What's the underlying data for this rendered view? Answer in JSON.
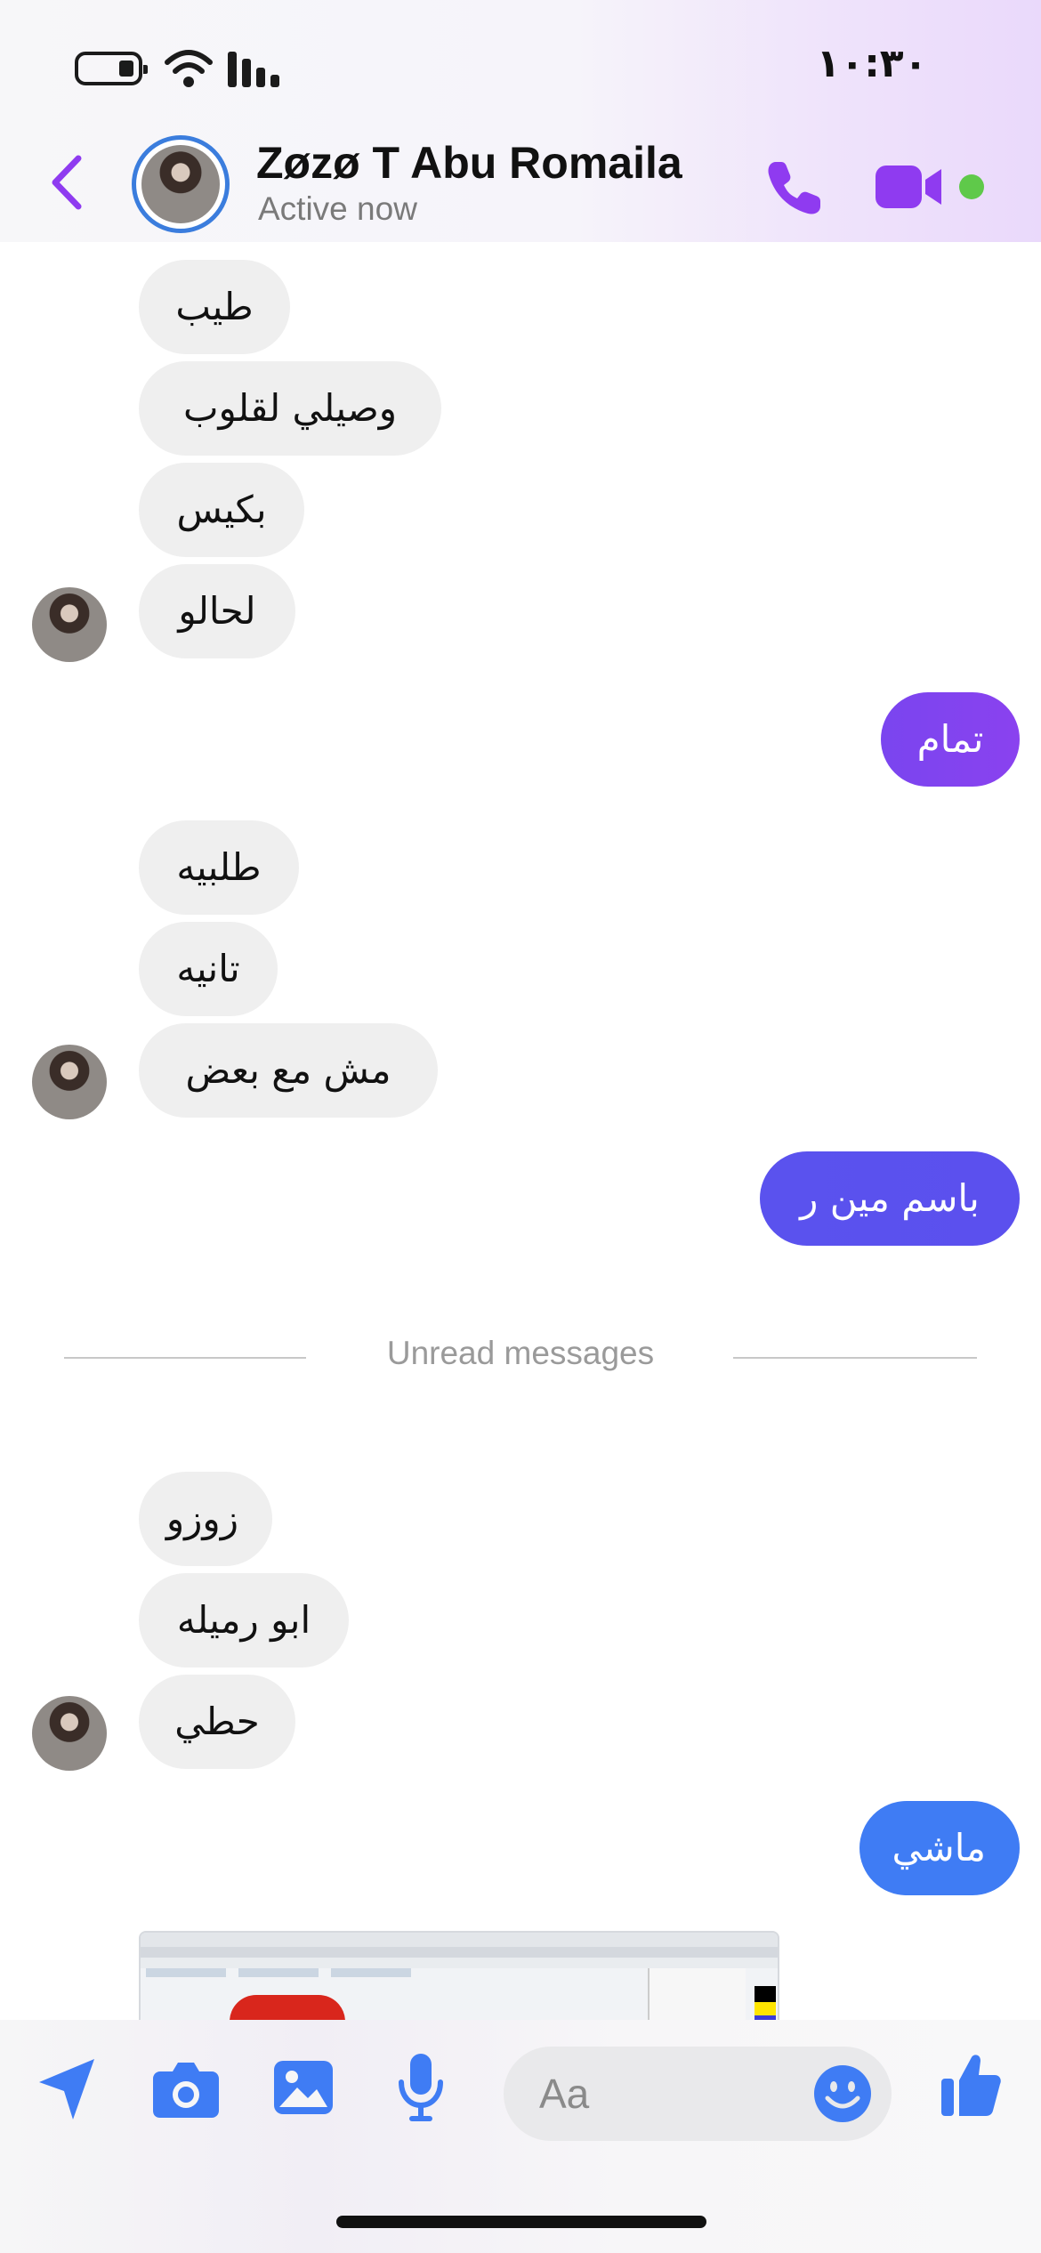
{
  "status_bar": {
    "time": "١٠:٣٠"
  },
  "header": {
    "contact_name": "Zøzø T Abu Romaila",
    "status": "Active now"
  },
  "colors": {
    "accent_purple": "#8f3bf0",
    "bubble_blue_gradient": [
      "#3f7cf4",
      "#5b50ee",
      "#7a45ef"
    ],
    "incoming_bubble": "#efefef",
    "online": "#5fc94a"
  },
  "messages": [
    {
      "side": "in",
      "text": "طيب"
    },
    {
      "side": "in",
      "text": "وصيلي لقلوب"
    },
    {
      "side": "in",
      "text": "بكيس"
    },
    {
      "side": "in",
      "text": "لحالو"
    },
    {
      "side": "out",
      "text": "تمام"
    },
    {
      "side": "in",
      "text": "طلبيه"
    },
    {
      "side": "in",
      "text": "تانيه"
    },
    {
      "side": "in",
      "text": "مش مع بعض"
    },
    {
      "side": "out",
      "text": "باسم مين ر"
    },
    {
      "side": "in",
      "text": "زوزو"
    },
    {
      "side": "in",
      "text": "ابو رميله"
    },
    {
      "side": "in",
      "text": "حطي"
    },
    {
      "side": "out",
      "text": "ماشي"
    }
  ],
  "divider": {
    "label": "Unread messages"
  },
  "composer": {
    "placeholder": "Aa",
    "icons": [
      "send-location-icon",
      "camera-icon",
      "gallery-icon",
      "microphone-icon",
      "emoji-icon",
      "thumbs-up-icon"
    ]
  }
}
